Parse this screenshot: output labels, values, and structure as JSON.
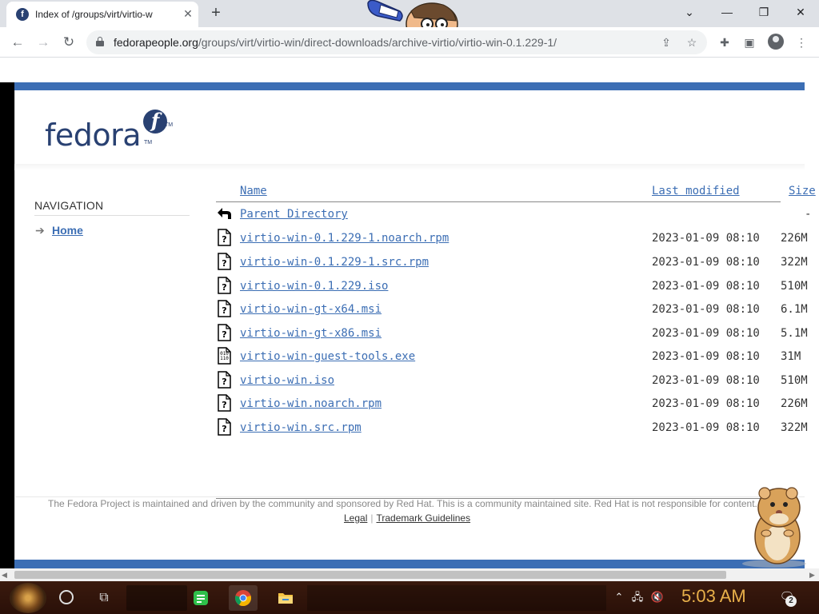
{
  "browser": {
    "tab_title": "Index of /groups/virt/virtio-w",
    "tab_close": "✕",
    "new_tab": "+",
    "url_host": "fedorapeople.org",
    "url_path": "/groups/virt/virtio-win/direct-downloads/archive-virtio/virtio-win-0.1.229-1/"
  },
  "page": {
    "logo_word": "fedora",
    "logo_mark": "f",
    "logo_tm": "TM",
    "navigation_heading": "NAVIGATION",
    "home_link": "Home",
    "columns": {
      "name": "Name",
      "last_modified": "Last modified",
      "size": "Size"
    },
    "parent_directory": "Parent Directory",
    "parent_size": "-",
    "files": [
      {
        "name": "virtio-win-0.1.229-1.noarch.rpm",
        "modified": "2023-01-09 08:10",
        "size": "226M",
        "icon": "unknown-file-icon"
      },
      {
        "name": "virtio-win-0.1.229-1.src.rpm",
        "modified": "2023-01-09 08:10",
        "size": "322M",
        "icon": "unknown-file-icon"
      },
      {
        "name": "virtio-win-0.1.229.iso",
        "modified": "2023-01-09 08:10",
        "size": "510M",
        "icon": "unknown-file-icon"
      },
      {
        "name": "virtio-win-gt-x64.msi",
        "modified": "2023-01-09 08:10",
        "size": "6.1M",
        "icon": "unknown-file-icon"
      },
      {
        "name": "virtio-win-gt-x86.msi",
        "modified": "2023-01-09 08:10",
        "size": "5.1M",
        "icon": "unknown-file-icon"
      },
      {
        "name": "virtio-win-guest-tools.exe",
        "modified": "2023-01-09 08:10",
        "size": "31M",
        "icon": "binary-file-icon"
      },
      {
        "name": "virtio-win.iso",
        "modified": "2023-01-09 08:10",
        "size": "510M",
        "icon": "unknown-file-icon"
      },
      {
        "name": "virtio-win.noarch.rpm",
        "modified": "2023-01-09 08:10",
        "size": "226M",
        "icon": "unknown-file-icon"
      },
      {
        "name": "virtio-win.src.rpm",
        "modified": "2023-01-09 08:10",
        "size": "322M",
        "icon": "unknown-file-icon"
      }
    ],
    "footer_text": "The Fedora Project is maintained and driven by the community and sponsored by Red Hat. This is a community maintained site. Red Hat is not responsible for content.",
    "footer_legal": "Legal",
    "footer_sep": "|",
    "footer_trademark": "Trademark Guidelines"
  },
  "taskbar": {
    "clock": "5:03 AM",
    "notification_count": "2"
  },
  "colors": {
    "fedora_blue": "#3c6eb4",
    "fedora_navy": "#294172",
    "taskbar_bg": "#2a1008",
    "clock_amber": "#e8b04a"
  }
}
